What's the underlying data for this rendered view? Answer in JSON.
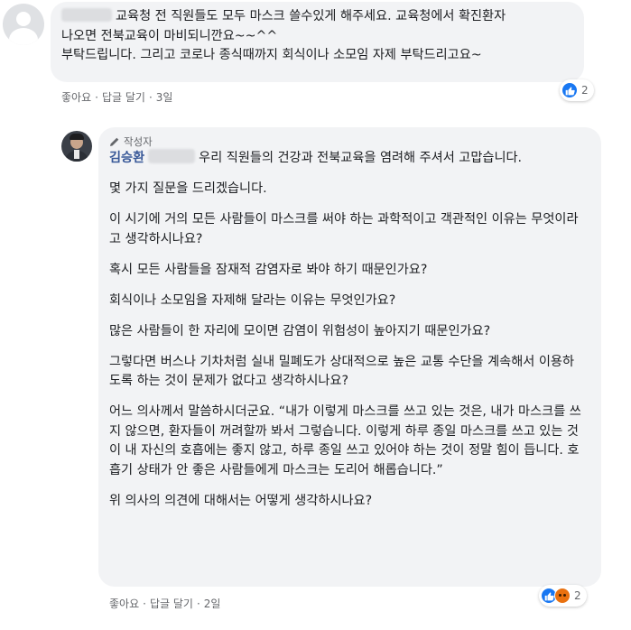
{
  "comment1": {
    "text_lines": [
      "교육청 전 직원들도 모두 마스크 쓸수있게 해주세요. 교육청에서 확진환자",
      "나오면 전북교육이 마비되니깐요~~^^",
      "부탁드립니다. 그리고 코로나 종식때까지 회식이나 소모임 자제 부탁드리고요~"
    ],
    "actions": {
      "like": "좋아요",
      "reply": "답글 달기",
      "time": "3일"
    },
    "reaction_count": "2"
  },
  "reply": {
    "badge": "작성자",
    "author": "김승환",
    "paragraphs": [
      "우리 직원들의 건강과 전북교육을 염려해 주셔서 고맙습니다.",
      "몇 가지 질문을 드리겠습니다.",
      "이 시기에 거의 모든 사람들이 마스크를 써야 하는 과학적이고 객관적인 이유는 무엇이라고 생각하시나요?",
      "혹시 모든 사람들을 잠재적 감염자로 봐야 하기 때문인가요?",
      "회식이나 소모임을 자제해 달라는 이유는 무엇인가요?",
      "많은 사람들이 한 자리에 모이면 감염이 위험성이 높아지기 때문인가요?",
      "그렇다면 버스나 기차처럼 실내 밀폐도가 상대적으로 높은 교통 수단을 계속해서 이용하도록 하는 것이 문제가 없다고 생각하시나요?",
      "어느 의사께서 말씀하시더군요. “내가 이렇게 마스크를 쓰고 있는 것은, 내가 마스크를 쓰지 않으면, 환자들이 꺼려할까 봐서 그렇습니다. 이렇게 하루 종일 마스크를 쓰고 있는 것이 내 자신의 호흡에는 좋지 않고, 하루 종일 쓰고 있어야 하는 것이 정말 힘이 듭니다. 호흡기 상태가 안 좋은 사람들에게 마스크는 도리어 해롭습니다.”",
      "위 의사의 의견에 대해서는 어떻게 생각하시나요?"
    ],
    "actions": {
      "like": "좋아요",
      "reply": "답글 달기",
      "time": "2일"
    },
    "reaction_count": "2"
  },
  "colors": {
    "bubble": "#f2f3f5",
    "link": "#385898",
    "meta": "#65676b",
    "like": "#1877f2",
    "angry": "#e9710f"
  }
}
